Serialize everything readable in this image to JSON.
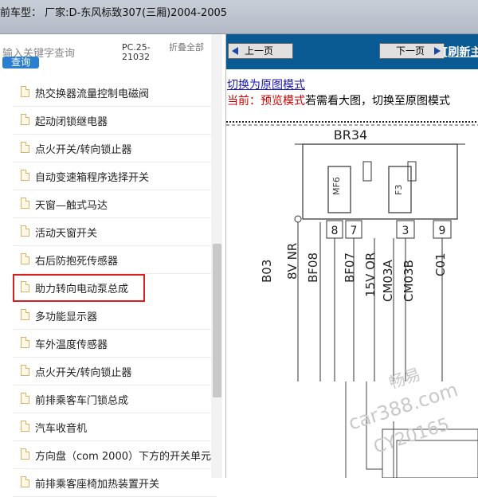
{
  "title": "前车型：  厂家:D-东风标致307(三厢)2004-2005",
  "left": {
    "search_placeholder": "输入关键字查询",
    "query_label": "查询",
    "code": "PC.25-21032",
    "fold_label": "折叠全部",
    "items": [
      {
        "label": "热交换器流量控制电磁阀"
      },
      {
        "label": "起动闭锁继电器"
      },
      {
        "label": "点火开关/转向锁止器"
      },
      {
        "label": "自动变速箱程序选择开关"
      },
      {
        "label": "天窗—触式马达"
      },
      {
        "label": "活动天窗开关"
      },
      {
        "label": "右后防抱死传感器"
      },
      {
        "label": "助力转向电动泵总成"
      },
      {
        "label": "多功能显示器"
      },
      {
        "label": "车外温度传感器"
      },
      {
        "label": "点火开关/转向锁止器"
      },
      {
        "label": "前排乘客车门锁总成"
      },
      {
        "label": "汽车收音机"
      },
      {
        "label": "方向盘（com 2000）下方的开关单元"
      },
      {
        "label": "前排乘客座椅加热装置开关"
      }
    ]
  },
  "right": {
    "prev_label": "上一页",
    "next_label": "下一页",
    "refresh_label": "[刷新主",
    "switch_link": "切换为原图模式",
    "current_prefix": "当前：",
    "current_mode": "预览模式",
    "hint": "若需看大图，切换至原图模式"
  },
  "diagram": {
    "connector": "BR34",
    "fuse1": "MF6",
    "fuse2": "F3",
    "pins": [
      "8",
      "7",
      "3",
      "9"
    ],
    "wires": [
      "B03",
      "8V NR",
      "BF08",
      "BF07",
      "15V OR",
      "CM03A",
      "CM03B",
      "C01"
    ],
    "watermark1": "畅易",
    "watermark2": "car388.com",
    "watermark3": "CY20165"
  }
}
